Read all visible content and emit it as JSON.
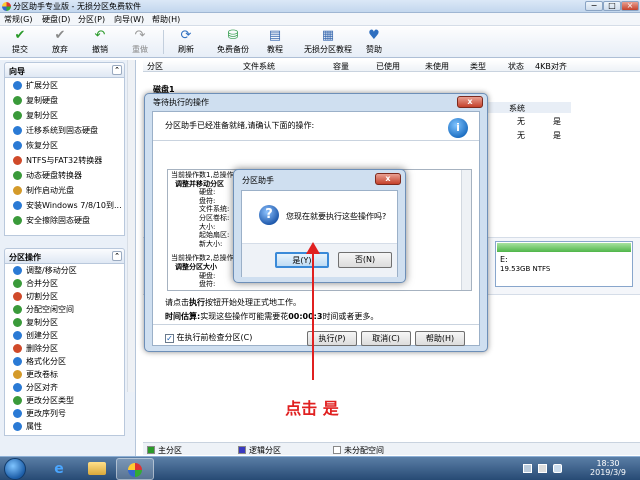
{
  "window": {
    "title": "分区助手专业版 - 无损分区免费软件",
    "controls": [
      "−",
      "□",
      "×"
    ]
  },
  "menu": [
    "常规(G)",
    "硬盘(D)",
    "分区(P)",
    "向导(W)",
    "帮助(H)"
  ],
  "toolbar": [
    {
      "label": "提交",
      "icon": "check-icon",
      "glyph": "✔",
      "color": "#2a9a2a"
    },
    {
      "label": "放弃",
      "icon": "discard-icon",
      "glyph": "✔",
      "color": "#8a8a8a"
    },
    {
      "label": "撤销",
      "icon": "undo-icon",
      "glyph": "↶",
      "color": "#2a9a2a"
    },
    {
      "label": "重做",
      "icon": "redo-icon",
      "glyph": "↷",
      "color": "#9a9a9a"
    },
    {
      "label": "刷新",
      "icon": "refresh-icon",
      "glyph": "⟳",
      "color": "#2f6fc0"
    },
    {
      "label": "免费备份",
      "icon": "backup-icon",
      "glyph": "⛁",
      "color": "#2f9a4a"
    },
    {
      "label": "教程",
      "icon": "tutorial-icon",
      "glyph": "▤",
      "color": "#3a6ab0"
    },
    {
      "label": "无损分区教程",
      "icon": "guide-icon",
      "glyph": "▦",
      "color": "#3a6ab0"
    },
    {
      "label": "赞助",
      "icon": "heart-icon",
      "glyph": "♥",
      "color": "#2f6fc0"
    }
  ],
  "sidebar": {
    "wizard": {
      "title": "向导",
      "collapse": "⌃",
      "items": [
        {
          "label": "扩展分区",
          "color": "#2a7ad5"
        },
        {
          "label": "复制硬盘",
          "color": "#3a9a3a"
        },
        {
          "label": "复制分区",
          "color": "#3a9a3a"
        },
        {
          "label": "迁移系统到固态硬盘",
          "color": "#2a7ad5"
        },
        {
          "label": "恢复分区",
          "color": "#2a7ad5"
        },
        {
          "label": "NTFS与FAT32转换器",
          "color": "#d04a2a"
        },
        {
          "label": "动态硬盘转换器",
          "color": "#3a9a3a"
        },
        {
          "label": "制作启动光盘",
          "color": "#d49a2a"
        },
        {
          "label": "安装Windows 7/8/10到...",
          "color": "#2a7ad5"
        },
        {
          "label": "安全擦除固态硬盘",
          "color": "#3a9a3a"
        }
      ]
    },
    "partition_ops": {
      "title": "分区操作",
      "collapse": "⌃",
      "items": [
        {
          "label": "调整/移动分区",
          "color": "#2a7ad5"
        },
        {
          "label": "合并分区",
          "color": "#3a9a3a"
        },
        {
          "label": "切割分区",
          "color": "#d04a2a"
        },
        {
          "label": "分配空闲空间",
          "color": "#3a9a3a"
        },
        {
          "label": "复制分区",
          "color": "#3a9a3a"
        },
        {
          "label": "创建分区",
          "color": "#2a7ad5"
        },
        {
          "label": "删除分区",
          "color": "#d04a2a"
        },
        {
          "label": "格式化分区",
          "color": "#2a7ad5"
        },
        {
          "label": "更改卷标",
          "color": "#d49a2a"
        },
        {
          "label": "分区对齐",
          "color": "#2a7ad5"
        },
        {
          "label": "更改分区类型",
          "color": "#3a9a3a"
        },
        {
          "label": "更改序列号",
          "color": "#2a7ad5"
        },
        {
          "label": "属性",
          "color": "#2a7ad5"
        }
      ]
    }
  },
  "columns": [
    "分区",
    "文件系统",
    "容量",
    "已使用",
    "未使用",
    "类型",
    "状态",
    "4KB对齐"
  ],
  "disk": {
    "header": "磁盘1",
    "rows": [
      {
        "status": "系统",
        "align": ""
      },
      {
        "status": "无",
        "align": "是"
      },
      {
        "status": "无",
        "align": "是"
      }
    ],
    "partition_card": {
      "name": "E:",
      "size": "19.53GB NTFS"
    }
  },
  "legend": [
    {
      "label": "主分区",
      "color": "#2a9a2a"
    },
    {
      "label": "逻辑分区",
      "color": "#3a3ac0"
    },
    {
      "label": "未分配空间",
      "color": "#ffffff"
    }
  ],
  "pending_dialog": {
    "title": "等待执行的操作",
    "close": "x",
    "message": "分区助手已经准备就绪,请确认下面的操作:",
    "ops_text": [
      "当前操作数1,总操作数2",
      "调整并移动分区",
      "硬盘:",
      "盘符:",
      "文件系统:",
      "分区卷标:",
      "大小:",
      "起始扇区:",
      "新大小:",
      "",
      "当前操作数2,总操作数2",
      "调整分区大小",
      "硬盘:",
      "盘符:"
    ],
    "hint_pre": "请点击",
    "hint_bold": "执行",
    "hint_post": "按钮开始处理正式地工作。",
    "time_label": "时间估算:",
    "time_pre": "实现这些操作可能需要花",
    "time_value": "00:00:3",
    "time_post": "时间或者更多。",
    "checkbox_label": "在执行前检查分区(C)",
    "checkbox_checked": true,
    "buttons": {
      "execute": "执行(P)",
      "cancel": "取消(C)",
      "help": "帮助(H)"
    }
  },
  "confirm_dialog": {
    "title": "分区助手",
    "close": "x",
    "question": "您现在就要执行这些操作吗?",
    "icon_glyph": "?",
    "yes": "是(Y)",
    "no": "否(N)"
  },
  "annotation": "点击 是",
  "taskbar": {
    "clock_time": "18:30",
    "clock_date": "2019/3/9"
  }
}
